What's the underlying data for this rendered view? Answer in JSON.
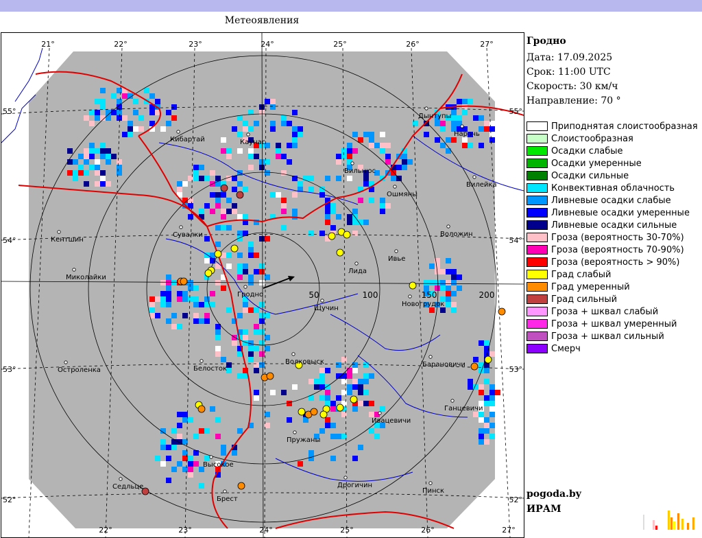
{
  "header": {
    "title": "Метеоявления"
  },
  "station": {
    "name": "Гродно",
    "date_label": "Дата: 17.09.2025",
    "time_label": "Срок: 11:00 UTC",
    "speed_label": "Скорость: 30  км/ч",
    "direction_label": "Направление:  70 °"
  },
  "legend": [
    {
      "label": "Приподнятая слоистообразная",
      "color": "#ffffff"
    },
    {
      "label": "Слоистообразная",
      "color": "#c8ffc8"
    },
    {
      "label": "Осадки слабые",
      "color": "#00e800"
    },
    {
      "label": "Осадки умеренные",
      "color": "#00b400"
    },
    {
      "label": "Осадки сильные",
      "color": "#008000"
    },
    {
      "label": "Конвективная облачность",
      "color": "#00e6ff"
    },
    {
      "label": "Ливневые осадки слабые",
      "color": "#0096ff"
    },
    {
      "label": "Ливневые осадки умеренные",
      "color": "#0000ff"
    },
    {
      "label": "Ливневые осадки сильные",
      "color": "#00008c"
    },
    {
      "label": "Гроза (вероятность 30-70%)",
      "color": "#ffc0c8"
    },
    {
      "label": "Гроза (вероятность 70-90%)",
      "color": "#ff00b4"
    },
    {
      "label": "Гроза (вероятность > 90%)",
      "color": "#ff0000"
    },
    {
      "label": "Град слабый",
      "color": "#ffff00"
    },
    {
      "label": "Град умеренный",
      "color": "#ff8c00"
    },
    {
      "label": "Град сильный",
      "color": "#c04040"
    },
    {
      "label": "Гроза + шквал слабый",
      "color": "#ff96ff"
    },
    {
      "label": "Гроза + шквал умеренный",
      "color": "#ff28e6"
    },
    {
      "label": "Гроза + шквал сильный",
      "color": "#c050c0"
    },
    {
      "label": "Смерч",
      "color": "#8c00ff"
    }
  ],
  "credits": {
    "site": "pogoda.by",
    "org": "ИРАМ"
  },
  "map": {
    "lon_labels_top": [
      "21°",
      "22°",
      "23°",
      "24°",
      "25°",
      "26°",
      "27°"
    ],
    "lon_labels_bottom": [
      "22°",
      "23°",
      "24°",
      "25°",
      "26°",
      "27°"
    ],
    "lat_labels_left": [
      "55°",
      "54°",
      "53°",
      "52°"
    ],
    "lat_labels_right": [
      "55°",
      "54°",
      "53°",
      "52°"
    ],
    "range_labels": [
      "50",
      "100",
      "150",
      "200"
    ],
    "cities": [
      "Кибартай",
      "Каунас",
      "Вильнюс",
      "Ошмяны",
      "Вилейка",
      "Нарочь",
      "Дынтупы",
      "Сувалки",
      "Кентшин",
      "Миколайки",
      "Гродно",
      "Щучин",
      "Лида",
      "Ивье",
      "Воложин",
      "Новогрудок",
      "Белосток",
      "Волковыск",
      "Барановичи",
      "Остроленка",
      "Ганцевичи",
      "Ивацевичи",
      "Пружаны",
      "Высокое",
      "Седльце",
      "Брест",
      "Дрогичин",
      "Пинск"
    ]
  },
  "colors": {
    "radar_area": "#b4b4b4",
    "border": "#e00000",
    "river": "#0000c8",
    "grid": "#000000",
    "topbar": "#b8b8ee"
  }
}
